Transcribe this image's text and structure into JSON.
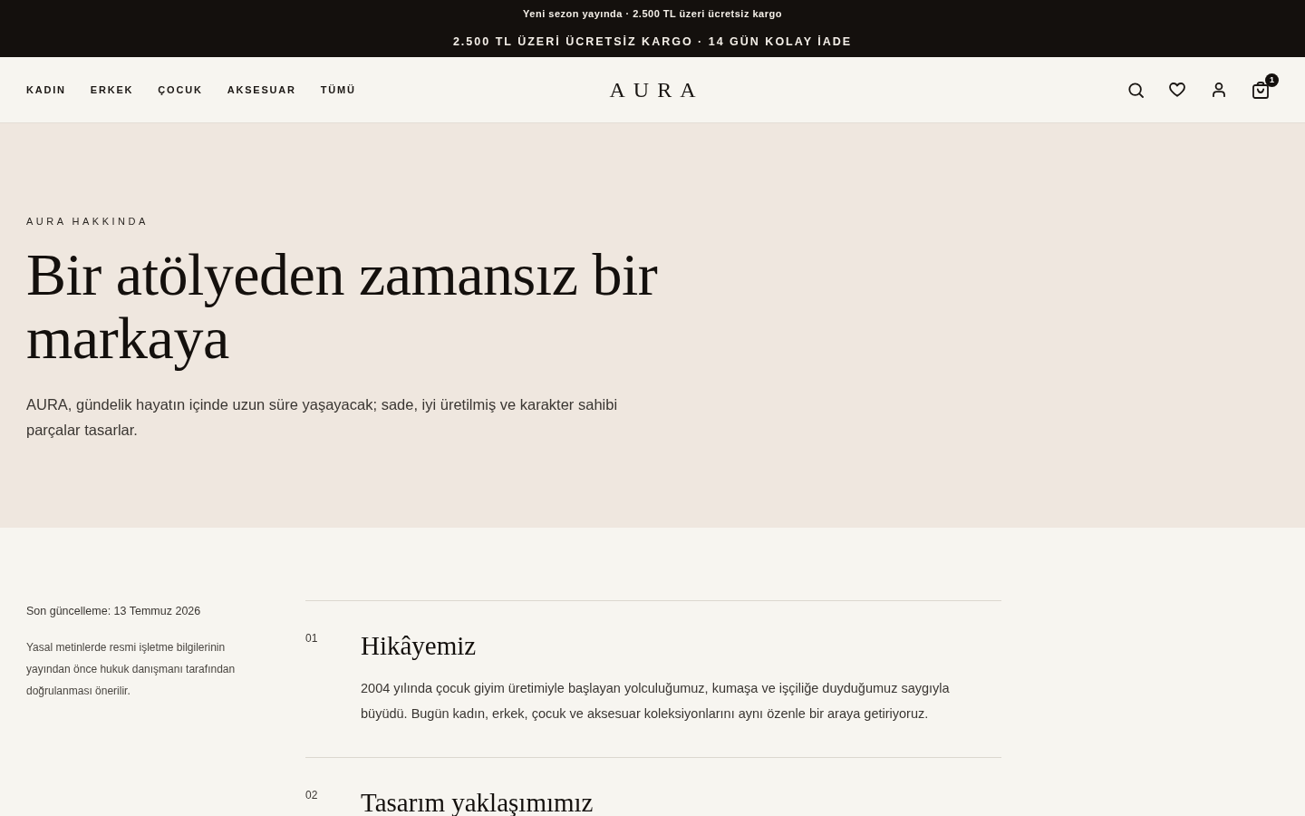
{
  "announcement_bar": {
    "lines": [
      {
        "kind": "ticker",
        "text": "Yeni sezon yayında · 2.500 TL üzeri ücretsiz kargo"
      },
      {
        "kind": "banner",
        "text": "2.500 TL ÜZERİ ÜCRETSİZ KARGO · 14 GÜN KOLAY İADE"
      }
    ]
  },
  "header": {
    "nav": [
      "KADIN",
      "ERKEK",
      "ÇOCUK",
      "AKSESUAR",
      "TÜMÜ"
    ],
    "logo": "AURA",
    "actions": [
      {
        "kind": "search"
      },
      {
        "kind": "wishlist"
      },
      {
        "kind": "account"
      },
      {
        "kind": "cart",
        "badge": "1"
      }
    ]
  },
  "hero": {
    "eyebrow": "AURA HAKKINDA",
    "title": "Bir atölyeden zamansız bir markaya",
    "lead": "AURA, gündelik hayatın içinde uzun süre yaşayacak; sade, iyi üretilmiş ve karakter sahibi parçalar tasarlar."
  },
  "aside": {
    "updated": "Son güncelleme: 13 Temmuz 2026",
    "note": "Yasal metinlerde resmi işletme bilgilerinin yayından önce hukuk danışmanı tarafından doğrulanması önerilir."
  },
  "sections": [
    {
      "number": "01",
      "title": "Hikâyemiz",
      "body": "2004 yılında çocuk giyim üretimiyle başlayan yolculuğumuz, kumaşa ve işçiliğe duyduğumuz saygıyla büyüdü. Bugün kadın, erkek, çocuk ve aksesuar koleksiyonlarını aynı özenle bir araya getiriyoruz."
    },
    {
      "number": "02",
      "title": "Tasarım yaklaşımımız"
    }
  ]
}
